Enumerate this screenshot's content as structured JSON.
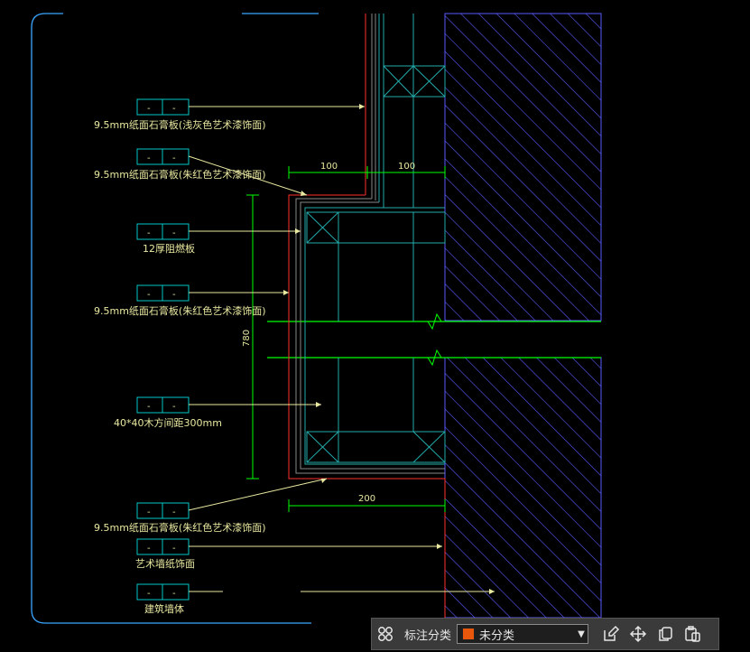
{
  "drawing": {
    "leaders": [
      {
        "label": "9.5mm纸面石膏板(浅灰色艺术漆饰面)"
      },
      {
        "label": "9.5mm纸面石膏板(朱红色艺术漆饰面)"
      },
      {
        "label": "12厚阻燃板"
      },
      {
        "label": "9.5mm纸面石膏板(朱红色艺术漆饰面)"
      },
      {
        "label": "40*40木方间距300mm"
      },
      {
        "label": "9.5mm纸面石膏板(朱红色艺术漆饰面)"
      },
      {
        "label": "艺术墙纸饰面"
      },
      {
        "label": "建筑墙体"
      }
    ],
    "tag_cell_text": "-",
    "dimensions": {
      "dim_top_left": "100",
      "dim_top_right": "100",
      "dim_vertical": "780",
      "dim_bottom": "200"
    }
  },
  "toolbar": {
    "label": "标注分类",
    "select_value": "未分类",
    "select_color": "#e8570c",
    "icons": [
      "grid-icon",
      "edit-icon",
      "move-icon",
      "copy-icon",
      "paste-icon"
    ]
  },
  "colors": {
    "background": "#000000",
    "annotation": "#e8e8a0",
    "tag_box": "#00c8c8",
    "wall_hatch": "#5a5aff",
    "finish_red": "#ff3030",
    "green_dim": "#00ff00",
    "frame": "#40b4ff"
  }
}
